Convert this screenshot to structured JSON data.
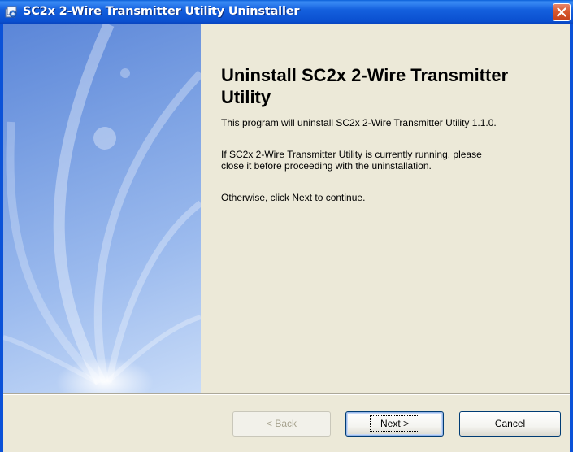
{
  "window": {
    "title": "SC2x 2-Wire Transmitter Utility Uninstaller"
  },
  "icons": {
    "app": "installer-app-icon",
    "close": "close-icon"
  },
  "content": {
    "heading": "Uninstall SC2x 2-Wire Transmitter Utility",
    "paragraphs": [
      "This program will uninstall SC2x 2-Wire Transmitter Utility 1.1.0.",
      "If SC2x 2-Wire Transmitter Utility is currently running, please\nclose it before proceeding with the uninstallation.",
      "Otherwise, click Next to continue."
    ]
  },
  "buttons": {
    "back": {
      "prefix": "< ",
      "mnemonic": "B",
      "rest": "ack",
      "enabled": false
    },
    "next": {
      "mnemonic": "N",
      "rest": "ext >",
      "enabled": true,
      "default": true
    },
    "cancel": {
      "mnemonic": "C",
      "rest": "ancel",
      "enabled": true
    }
  },
  "colors": {
    "titlebar": "#0a4fcf",
    "dialog_background": "#ece9d8",
    "close_button": "#d8582f"
  }
}
